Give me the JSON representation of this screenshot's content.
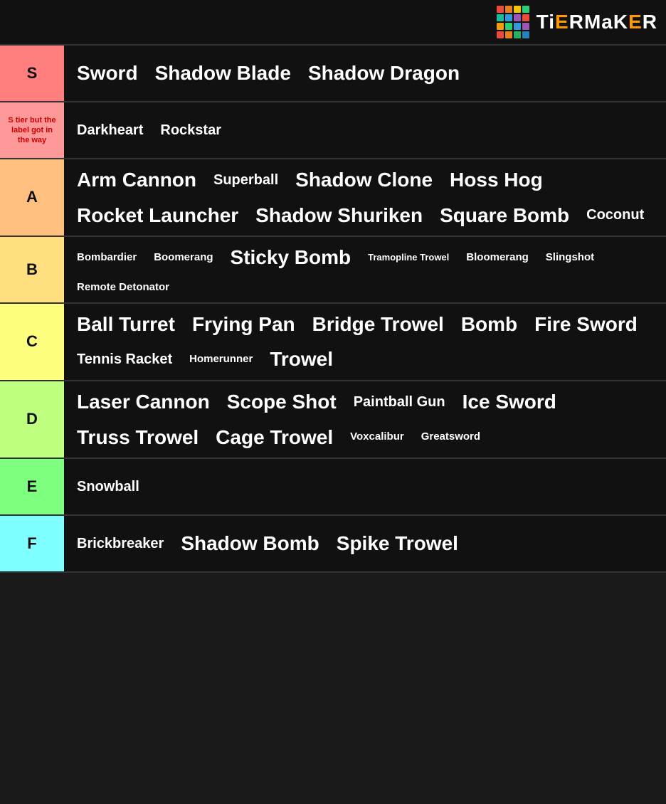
{
  "logo": {
    "text": "TiERMaKeR"
  },
  "tiers": [
    {
      "id": "s",
      "label": "S",
      "color": "s-color",
      "items": [
        {
          "text": "Sword",
          "size": "large"
        },
        {
          "text": "Shadow Blade",
          "size": "large"
        },
        {
          "text": "Shadow Dragon",
          "size": "large"
        }
      ]
    },
    {
      "id": "s2",
      "label": "S tier but the label got in the way",
      "color": "s2-color",
      "labelSize": 11,
      "items": [
        {
          "text": "Darkheart",
          "size": "medium"
        },
        {
          "text": "Rockstar",
          "size": "medium"
        }
      ]
    },
    {
      "id": "a",
      "label": "A",
      "color": "a-color",
      "items": [
        {
          "text": "Arm Cannon",
          "size": "large"
        },
        {
          "text": "Superball",
          "size": "medium"
        },
        {
          "text": "Shadow Clone",
          "size": "large"
        },
        {
          "text": "Hoss Hog",
          "size": "large"
        },
        {
          "text": "Rocket Launcher",
          "size": "large"
        },
        {
          "text": "Shadow Shuriken",
          "size": "large"
        },
        {
          "text": "Square Bomb",
          "size": "large"
        },
        {
          "text": "Coconut",
          "size": "medium"
        }
      ]
    },
    {
      "id": "b",
      "label": "B",
      "color": "b-color",
      "items": [
        {
          "text": "Bombardier",
          "size": "small"
        },
        {
          "text": "Boomerang",
          "size": "small"
        },
        {
          "text": "Sticky Bomb",
          "size": "large"
        },
        {
          "text": "Tramopline Trowel",
          "size": "xsmall"
        },
        {
          "text": "Bloomerang",
          "size": "small"
        },
        {
          "text": "Slingshot",
          "size": "small"
        },
        {
          "text": "Remote Detonator",
          "size": "small"
        }
      ]
    },
    {
      "id": "c",
      "label": "C",
      "color": "c-color",
      "items": [
        {
          "text": "Ball Turret",
          "size": "large"
        },
        {
          "text": "Frying Pan",
          "size": "large"
        },
        {
          "text": "Bridge Trowel",
          "size": "large"
        },
        {
          "text": "Bomb",
          "size": "large"
        },
        {
          "text": "Fire Sword",
          "size": "large"
        },
        {
          "text": "Tennis Racket",
          "size": "medium"
        },
        {
          "text": "Homerunner",
          "size": "small"
        },
        {
          "text": "Trowel",
          "size": "large"
        }
      ]
    },
    {
      "id": "d",
      "label": "D",
      "color": "d-color",
      "items": [
        {
          "text": "Laser Cannon",
          "size": "large"
        },
        {
          "text": "Scope Shot",
          "size": "large"
        },
        {
          "text": "Paintball Gun",
          "size": "medium"
        },
        {
          "text": "Ice Sword",
          "size": "large"
        },
        {
          "text": "Truss Trowel",
          "size": "large"
        },
        {
          "text": "Cage Trowel",
          "size": "large"
        },
        {
          "text": "Voxcalibur",
          "size": "small"
        },
        {
          "text": "Greatsword",
          "size": "small"
        }
      ]
    },
    {
      "id": "e",
      "label": "E",
      "color": "e-color",
      "items": [
        {
          "text": "Snowball",
          "size": "medium"
        }
      ]
    },
    {
      "id": "f",
      "label": "F",
      "color": "f-color",
      "items": [
        {
          "text": "Brickbreaker",
          "size": "medium"
        },
        {
          "text": "Shadow Bomb",
          "size": "large"
        },
        {
          "text": "Spike Trowel",
          "size": "large"
        }
      ]
    }
  ],
  "logo_colors": [
    "#e74c3c",
    "#e67e22",
    "#f1c40f",
    "#2ecc71",
    "#1abc9c",
    "#3498db",
    "#9b59b6",
    "#e74c3c",
    "#f39c12",
    "#2ecc71",
    "#3498db",
    "#9b59b6",
    "#e74c3c",
    "#e67e22",
    "#27ae60",
    "#2980b9"
  ]
}
